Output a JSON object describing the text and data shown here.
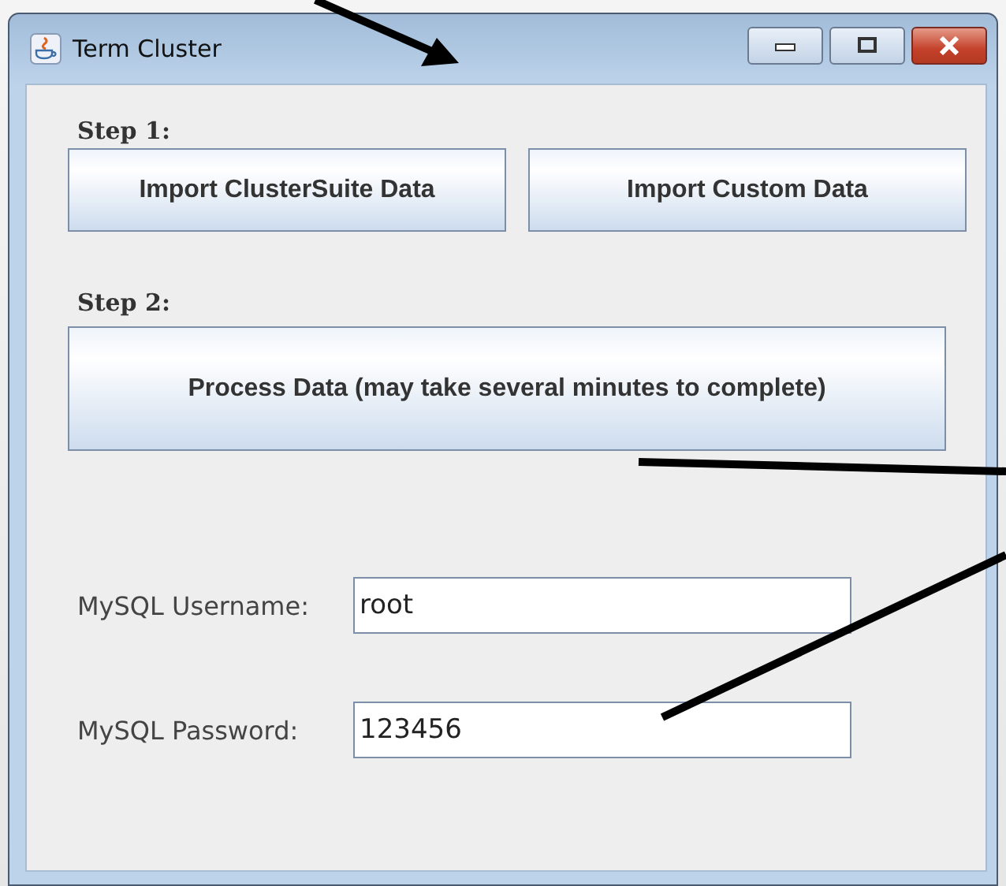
{
  "window": {
    "title": "Term Cluster"
  },
  "step1": {
    "label": "Step 1:",
    "buttons": [
      "Import ClusterSuite Data",
      "Import Custom Data"
    ]
  },
  "step2": {
    "label": "Step 2:",
    "button": "Process Data (may take several minutes to complete)"
  },
  "fields": [
    {
      "label": "MySQL Username:",
      "value": "root"
    },
    {
      "label": "MySQL Password:",
      "value": "123456"
    }
  ]
}
